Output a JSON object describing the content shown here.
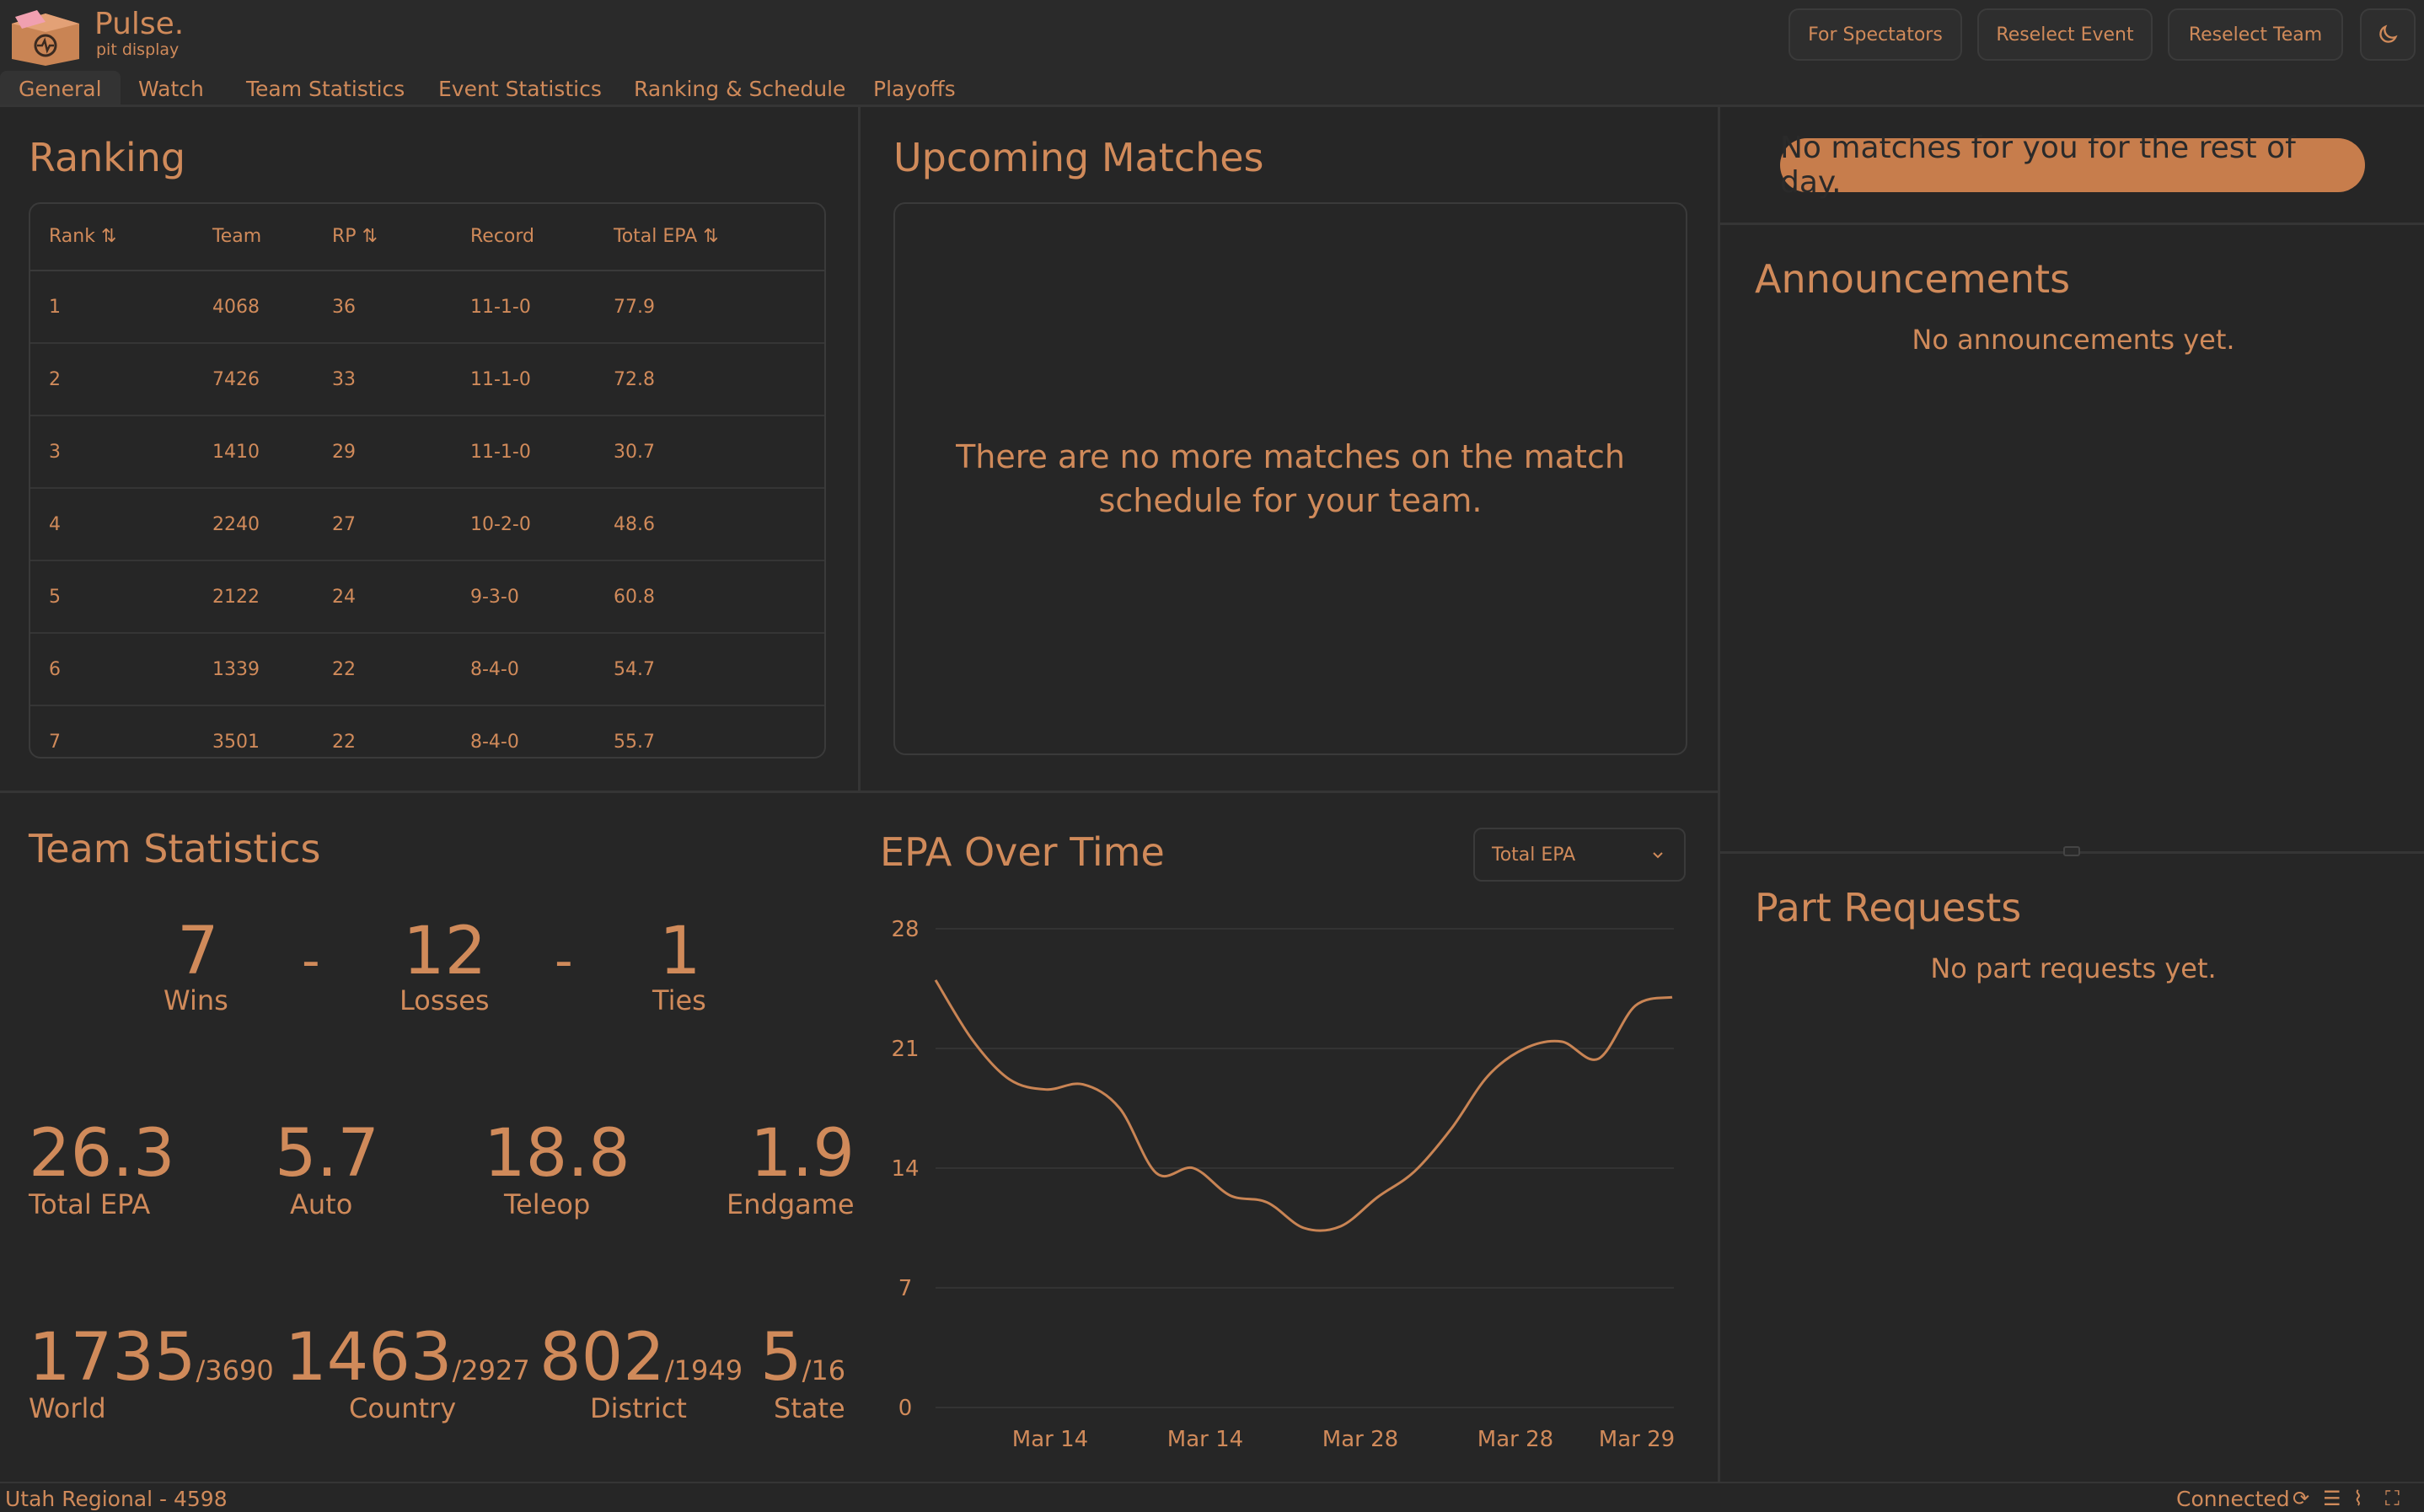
{
  "brand": {
    "title": "Pulse.",
    "subtitle": "pit display"
  },
  "header_buttons": [
    "For Spectators",
    "Reselect Event",
    "Reselect Team"
  ],
  "tabs": [
    "General",
    "Watch",
    "Team Statistics",
    "Event Statistics",
    "Ranking & Schedule",
    "Playoffs"
  ],
  "ranking": {
    "title": "Ranking",
    "columns": [
      "Rank",
      "Team",
      "RP",
      "Record",
      "Total EPA"
    ],
    "rows": [
      [
        "1",
        "4068",
        "36",
        "11-1-0",
        "77.9"
      ],
      [
        "2",
        "7426",
        "33",
        "11-1-0",
        "72.8"
      ],
      [
        "3",
        "1410",
        "29",
        "11-1-0",
        "30.7"
      ],
      [
        "4",
        "2240",
        "27",
        "10-2-0",
        "48.6"
      ],
      [
        "5",
        "2122",
        "24",
        "9-3-0",
        "60.8"
      ],
      [
        "6",
        "1339",
        "22",
        "8-4-0",
        "54.7"
      ],
      [
        "7",
        "3501",
        "22",
        "8-4-0",
        "55.7"
      ]
    ]
  },
  "upcoming": {
    "title": "Upcoming Matches",
    "message": "There are no more matches on the match schedule for your team."
  },
  "right": {
    "pill": "No matches for you for the rest of day.",
    "announcements_title": "Announcements",
    "announcements_empty": "No announcements yet.",
    "parts_title": "Part Requests",
    "parts_empty": "No part requests yet."
  },
  "team_stats": {
    "title": "Team Statistics",
    "wins": "7",
    "wins_label": "Wins",
    "losses": "12",
    "losses_label": "Losses",
    "ties": "1",
    "ties_label": "Ties",
    "sep": "-",
    "total_epa": "26.3",
    "total_epa_label": "Total EPA",
    "auto": "5.7",
    "auto_label": "Auto",
    "teleop": "18.8",
    "teleop_label": "Teleop",
    "endgame": "1.9",
    "endgame_label": "Endgame",
    "world": "1735",
    "world_of": "/3690",
    "world_label": "World",
    "country": "1463",
    "country_of": "/2927",
    "country_label": "Country",
    "district": "802",
    "district_of": "/1949",
    "district_label": "District",
    "state": "5",
    "state_of": "/16",
    "state_label": "State"
  },
  "epa_chart": {
    "title": "EPA Over Time",
    "select_value": "Total EPA"
  },
  "chart_data": {
    "type": "line",
    "title": "",
    "xlabel": "",
    "ylabel": "",
    "ylim": [
      0,
      28
    ],
    "yticks": [
      "28",
      "21",
      "14",
      "7",
      "0"
    ],
    "xtick_labels": [
      "Mar 14",
      "Mar 14",
      "Mar 28",
      "Mar 28",
      "Mar 29"
    ],
    "grid": true,
    "series": [
      {
        "values": [
          25.0,
          21.5,
          19.2,
          18.6,
          18.9,
          17.5,
          13.7,
          14.0,
          12.4,
          12.0,
          10.5,
          10.6,
          12.3,
          13.8,
          16.3,
          19.4,
          21.0,
          21.4,
          20.4,
          23.5,
          24.0
        ]
      }
    ],
    "line_color": "#c98454"
  },
  "footer": {
    "event": "Utah Regional - 4598",
    "status": "Connected"
  }
}
